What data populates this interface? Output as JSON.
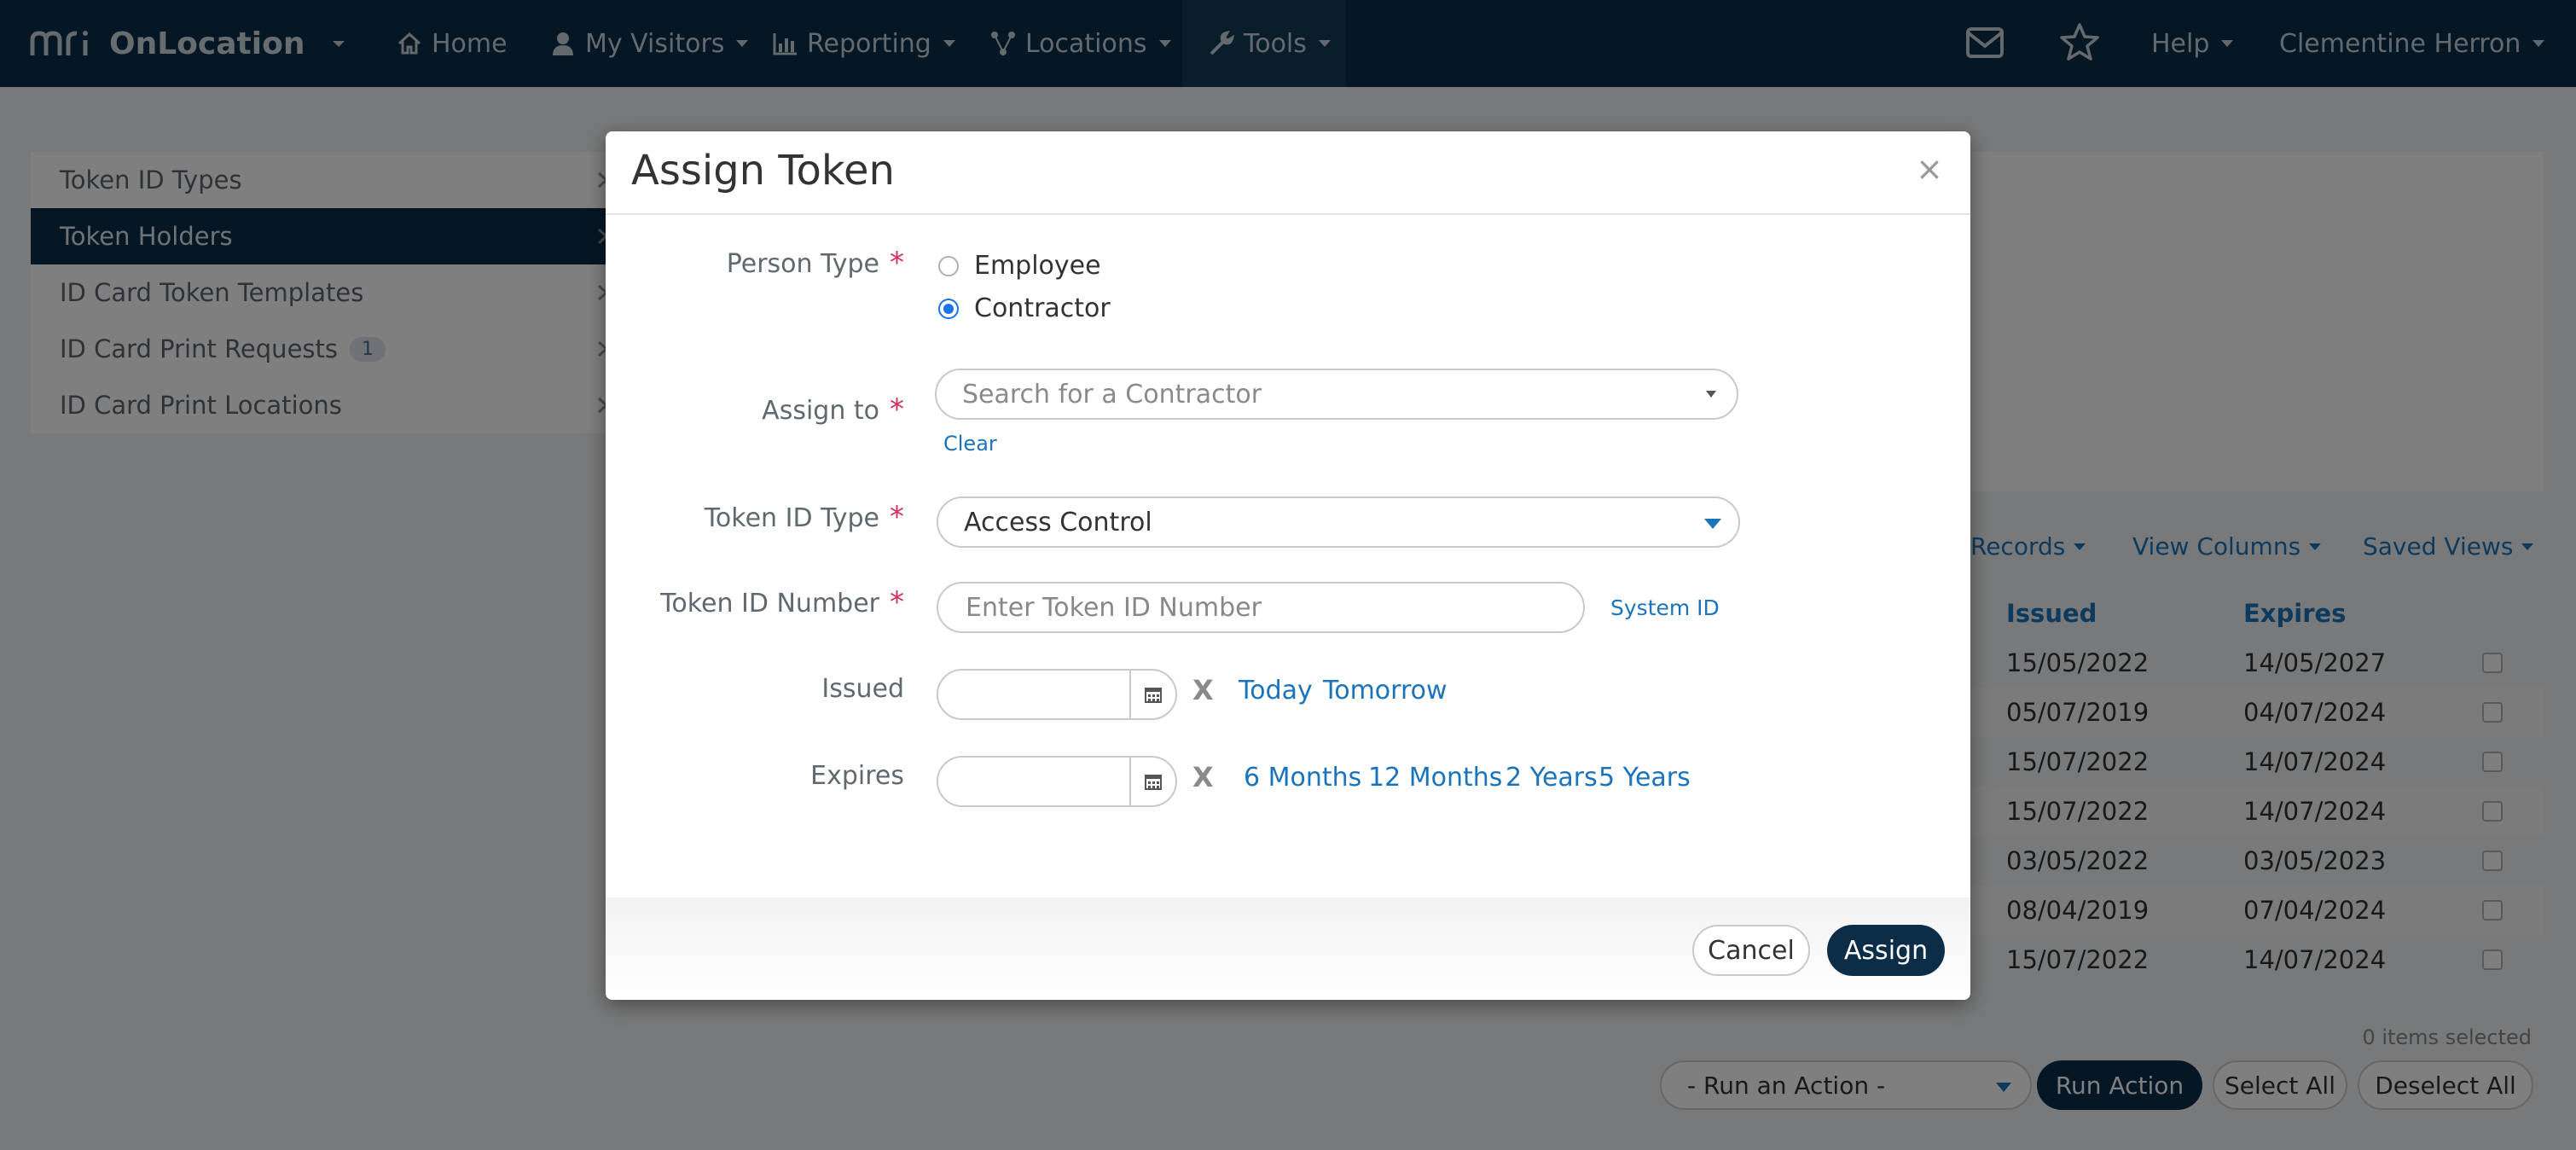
{
  "app": {
    "brand_name": "OnLocation"
  },
  "nav": {
    "home": "Home",
    "my_visitors": "My Visitors",
    "reporting": "Reporting",
    "locations": "Locations",
    "tools": "Tools",
    "help": "Help",
    "user_name": "Clementine Herron"
  },
  "sidebar": {
    "items": [
      {
        "label": "Token ID Types"
      },
      {
        "label": "Token Holders",
        "active": true
      },
      {
        "label": "ID Card Token Templates"
      },
      {
        "label": "ID Card Print Requests",
        "badge": "1"
      },
      {
        "label": "ID Card Print Locations"
      }
    ]
  },
  "table_toolbar": {
    "records": "Records",
    "view_columns": "View Columns",
    "saved_views": "Saved Views"
  },
  "table": {
    "columns": [
      "Issued",
      "Expires"
    ],
    "rows": [
      [
        "15/05/2022",
        "14/05/2027"
      ],
      [
        "05/07/2019",
        "04/07/2024"
      ],
      [
        "15/07/2022",
        "14/07/2024"
      ],
      [
        "15/07/2022",
        "14/07/2024"
      ],
      [
        "03/05/2022",
        "03/05/2023"
      ],
      [
        "08/04/2019",
        "07/04/2024"
      ],
      [
        "15/07/2022",
        "14/07/2024"
      ]
    ]
  },
  "footer_actions": {
    "items_selected": "0 items selected",
    "run_action_placeholder": "- Run an Action -",
    "run_action": "Run Action",
    "select_all": "Select All",
    "deselect_all": "Deselect All"
  },
  "modal": {
    "title": "Assign Token",
    "close": "×",
    "required_mark": "*",
    "person_type": {
      "label": "Person Type",
      "options": [
        "Employee",
        "Contractor"
      ],
      "selected": "Contractor"
    },
    "assign_to": {
      "label": "Assign to",
      "placeholder": "Search for a Contractor",
      "clear": "Clear"
    },
    "token_id_type": {
      "label": "Token ID Type",
      "value": "Access Control"
    },
    "token_id_number": {
      "label": "Token ID Number",
      "placeholder": "Enter Token ID Number",
      "system_id": "System ID"
    },
    "issued": {
      "label": "Issued",
      "clear": "X",
      "shortcuts": [
        "Today",
        "Tomorrow"
      ]
    },
    "expires": {
      "label": "Expires",
      "clear": "X",
      "shortcuts": [
        "6 Months",
        "12 Months",
        "2 Years",
        "5 Years"
      ]
    },
    "buttons": {
      "cancel": "Cancel",
      "assign": "Assign"
    }
  },
  "colors": {
    "navbar": "#0b2d48",
    "accent": "#1b74bb",
    "required": "#d32f5e",
    "radio_checked": "#1a73e8"
  }
}
